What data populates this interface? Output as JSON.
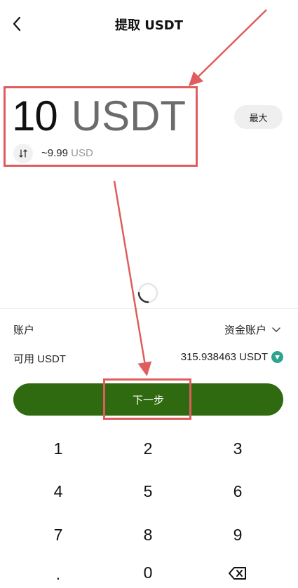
{
  "header": {
    "title": "提取 USDT"
  },
  "amount": {
    "value": "10",
    "unit": "USDT",
    "approx_value": "~9.99",
    "approx_unit": "USD"
  },
  "max_label": "最大",
  "account": {
    "label": "账户",
    "value": "资金账户"
  },
  "available": {
    "label": "可用 USDT",
    "value": "315.938463 USDT"
  },
  "next_label": "下一步",
  "keypad": {
    "k1": "1",
    "k2": "2",
    "k3": "3",
    "k4": "4",
    "k5": "5",
    "k6": "6",
    "k7": "7",
    "k8": "8",
    "k9": "9",
    "kdot": ".",
    "k0": "0"
  },
  "colors": {
    "primary": "#2f6a10",
    "annotation": "#e05d5d"
  },
  "icons": [
    "chevron-left-icon",
    "swap-icon",
    "loading-spinner-icon",
    "chevron-down-icon",
    "diamond-badge-icon",
    "backspace-icon"
  ]
}
